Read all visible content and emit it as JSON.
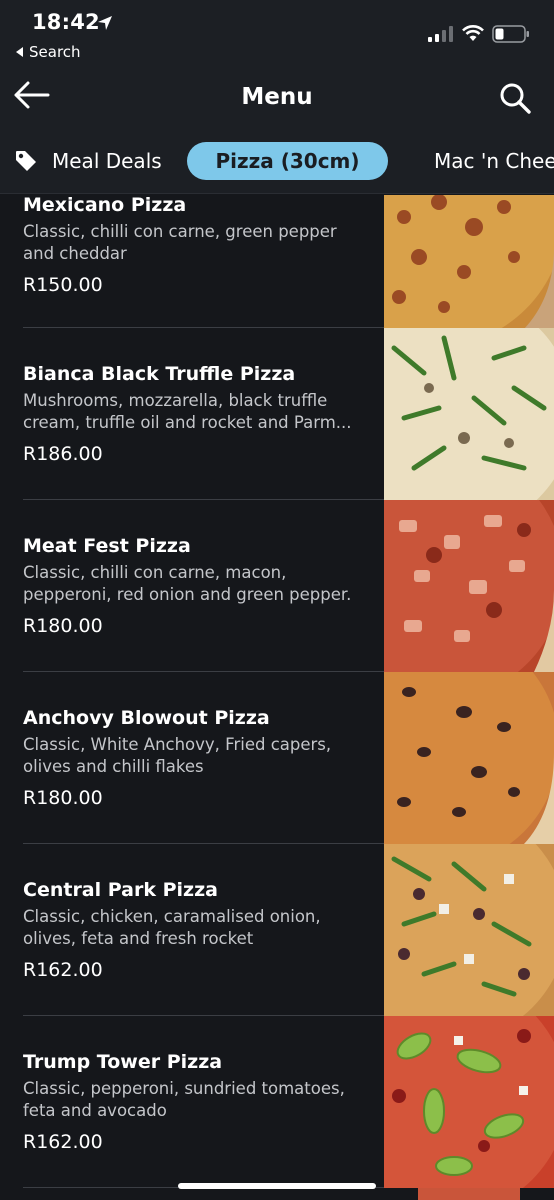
{
  "status_bar": {
    "time": "18:42",
    "back_app": "Search"
  },
  "header": {
    "title": "Menu"
  },
  "tabs": [
    {
      "label": "Meal Deals",
      "icon": "tag-icon"
    },
    {
      "label": "Pizza (30cm)",
      "selected": true
    },
    {
      "label": "Mac 'n Chee"
    }
  ],
  "menu_items": [
    {
      "name": "Mexicano Pizza",
      "description": "Classic, chilli con carne, green pepper and cheddar",
      "price": "R150.00"
    },
    {
      "name": "Bianca Black Truffle  Pizza",
      "description": "Mushrooms, mozzarella, black truffle cream, truffle oil and rocket and Parm...",
      "price": "R186.00"
    },
    {
      "name": "Meat Fest Pizza",
      "description": "Classic, chilli con carne, macon, pepperoni, red onion and green pepper.",
      "price": "R180.00"
    },
    {
      "name": "Anchovy Blowout Pizza",
      "description": "Classic, White Anchovy,  Fried capers, olives and chilli flakes",
      "price": "R180.00"
    },
    {
      "name": "Central Park Pizza",
      "description": "Classic, chicken, caramalised onion, olives, feta and fresh rocket",
      "price": "R162.00"
    },
    {
      "name": "Trump Tower Pizza",
      "description": "Classic, pepperoni, sundried tomatoes, feta and avocado",
      "price": "R162.00"
    }
  ],
  "colors": {
    "background": "#15171b",
    "accent_tab": "#7ec8ea"
  }
}
